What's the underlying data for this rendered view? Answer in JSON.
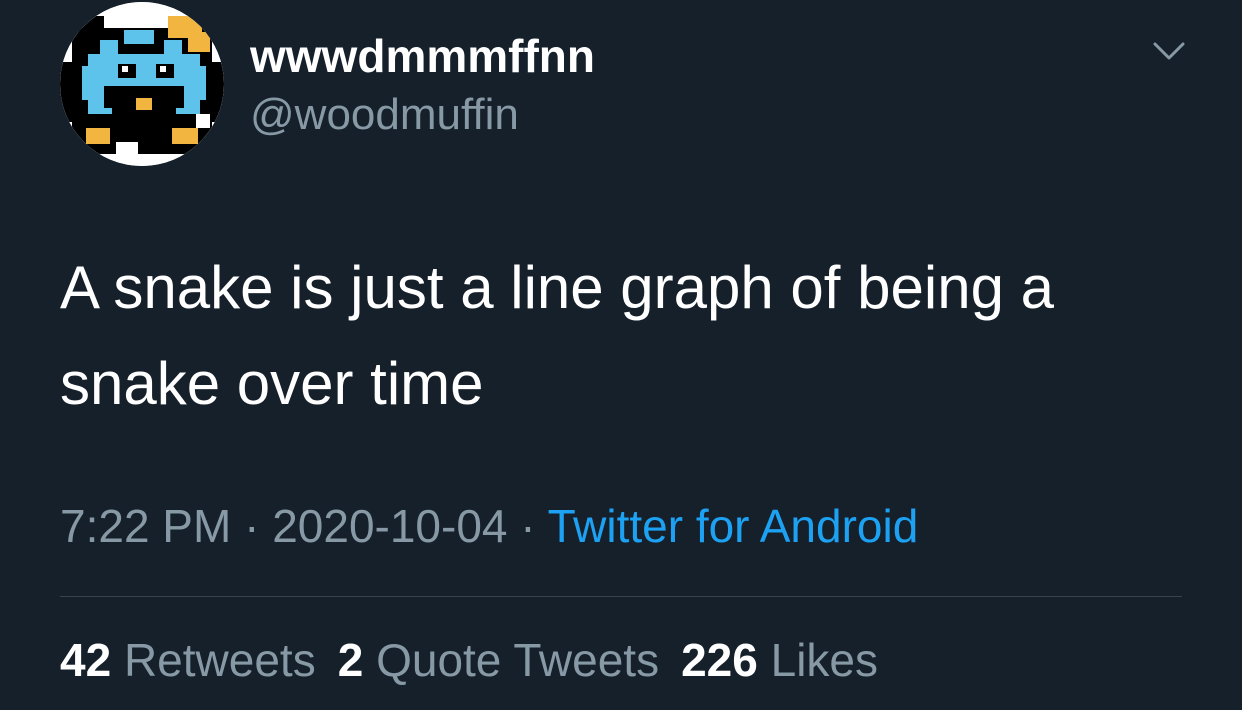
{
  "user": {
    "display_name": "wwwdmmmffnn",
    "handle": "@woodmuffin",
    "avatar_icon": "pixel-character-avatar"
  },
  "menu": {
    "icon": "chevron-down-icon"
  },
  "tweet": {
    "text": "A snake is just a line graph of being a snake over time"
  },
  "meta": {
    "time": "7:22 PM",
    "separator": " · ",
    "date": "2020-10-04",
    "source": "Twitter for Android"
  },
  "stats": {
    "retweets_count": "42",
    "retweets_label": "Retweets",
    "quote_count": "2",
    "quote_label": "Quote Tweets",
    "likes_count": "226",
    "likes_label": "Likes"
  },
  "colors": {
    "background": "#15202b",
    "text": "#ffffff",
    "secondary": "#8899a6",
    "link": "#1da1f2",
    "divider": "#38444d"
  }
}
